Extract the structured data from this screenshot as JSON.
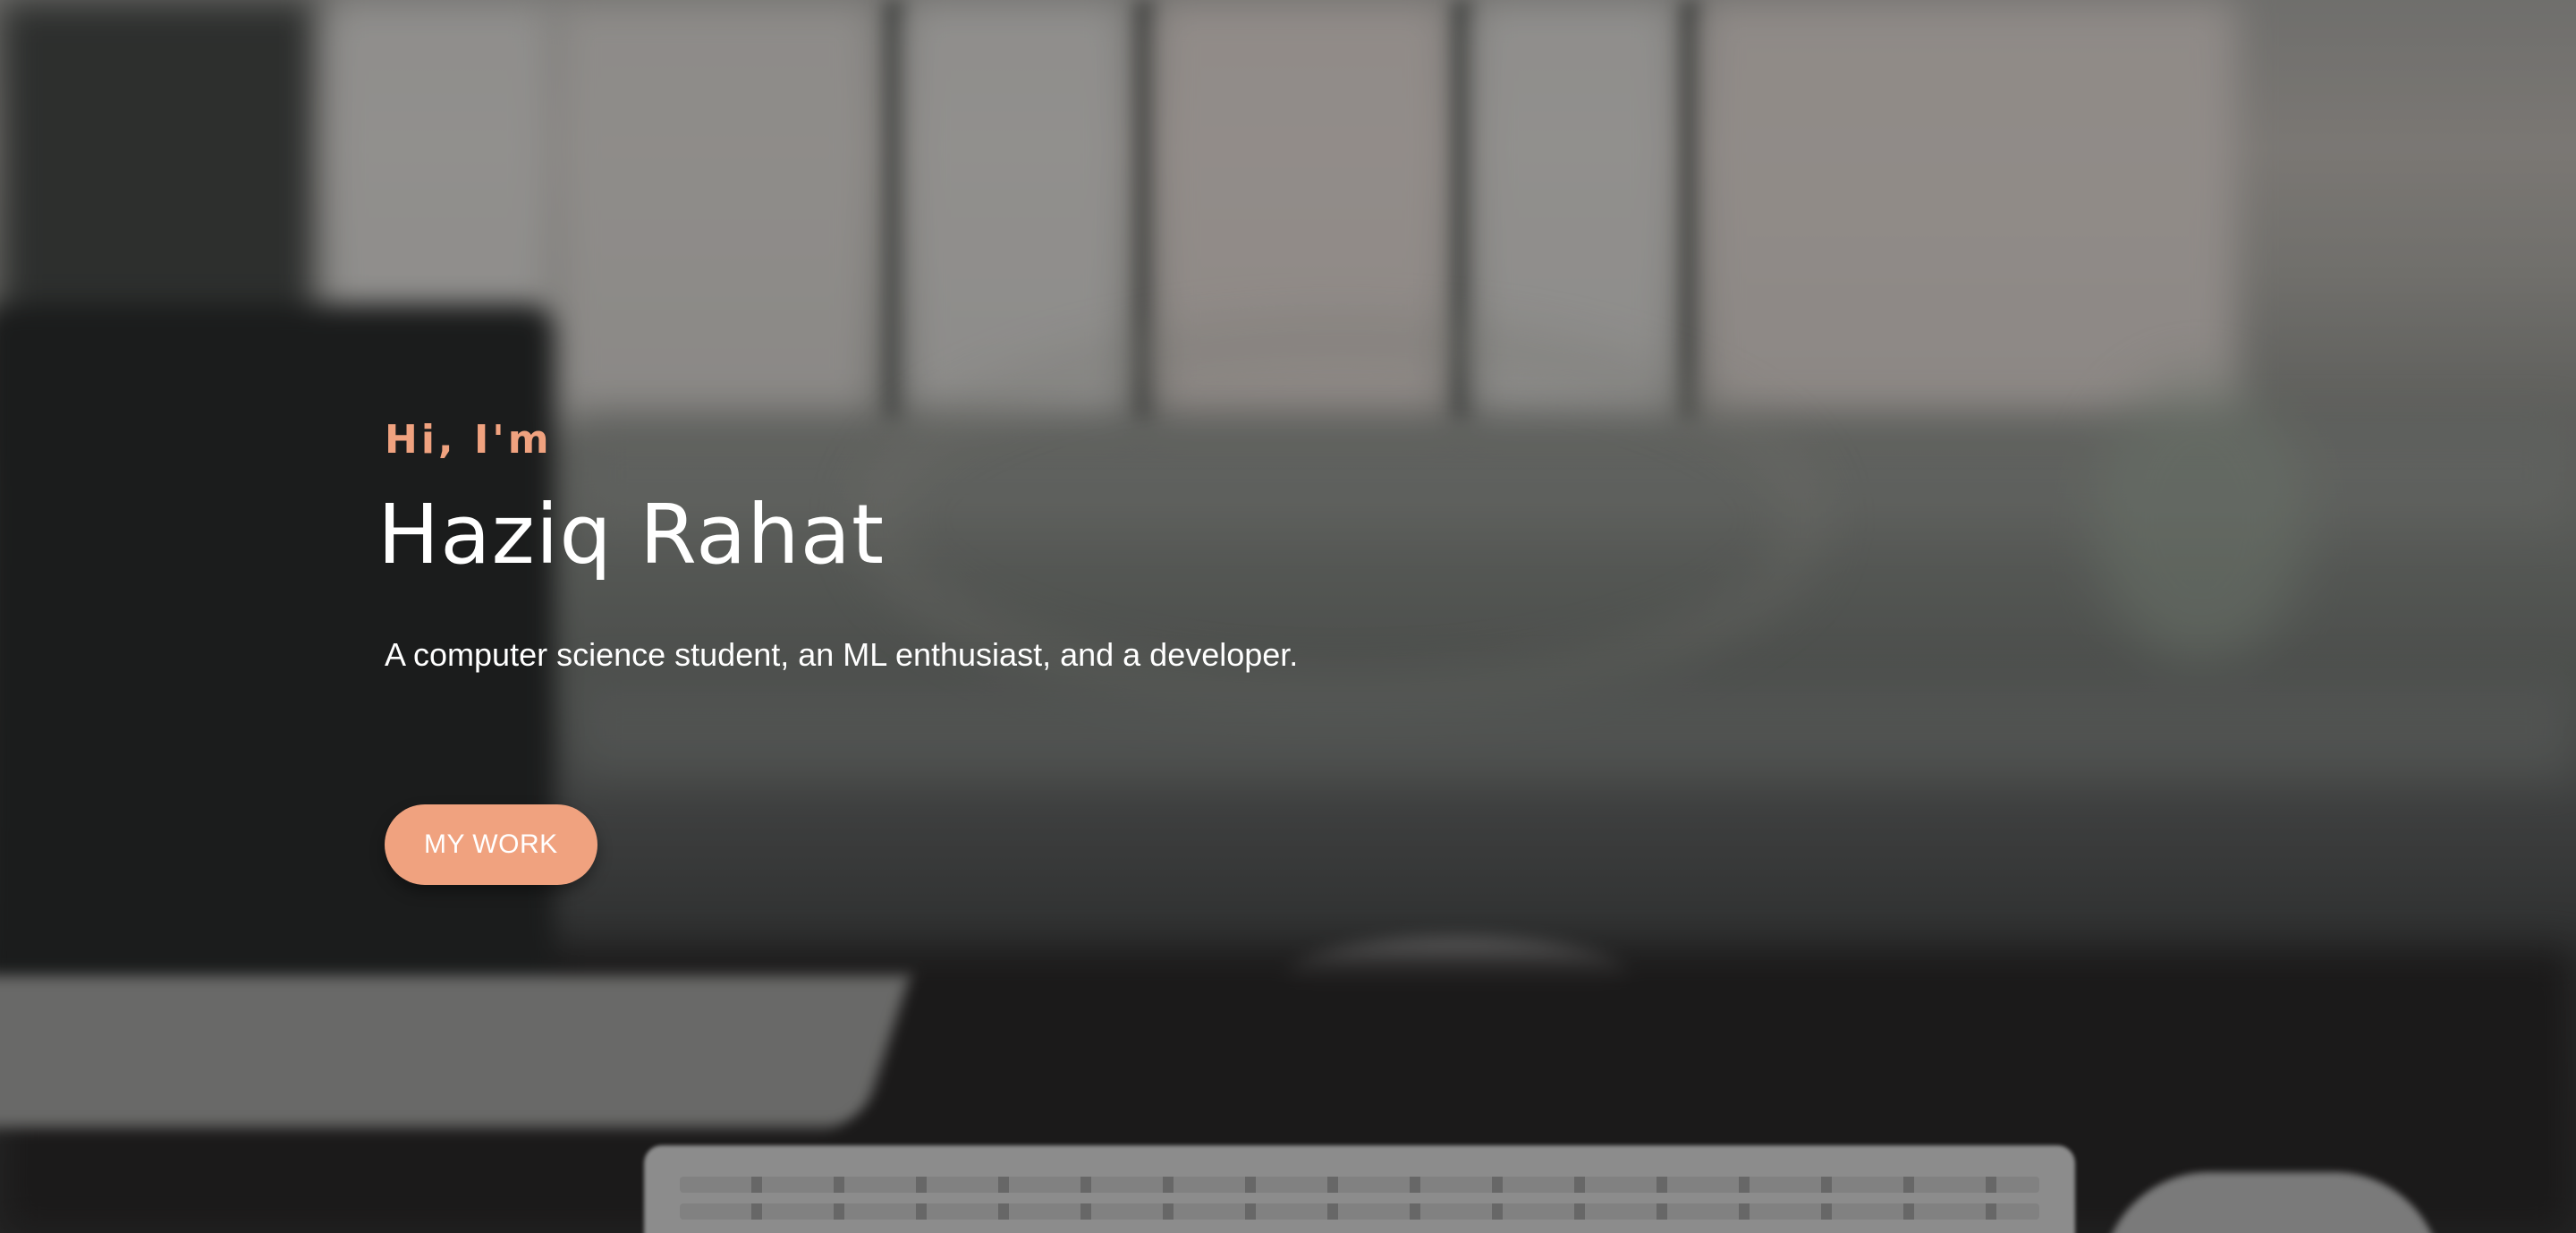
{
  "hero": {
    "greeting": "Hi, I'm",
    "name": "Haziq Rahat",
    "tagline": "A computer science student, an ML enthusiast, and a developer.",
    "cta_label": "MY WORK"
  },
  "colors": {
    "accent": "#f0a27f",
    "text": "#ffffff",
    "overlay": "#141616"
  }
}
